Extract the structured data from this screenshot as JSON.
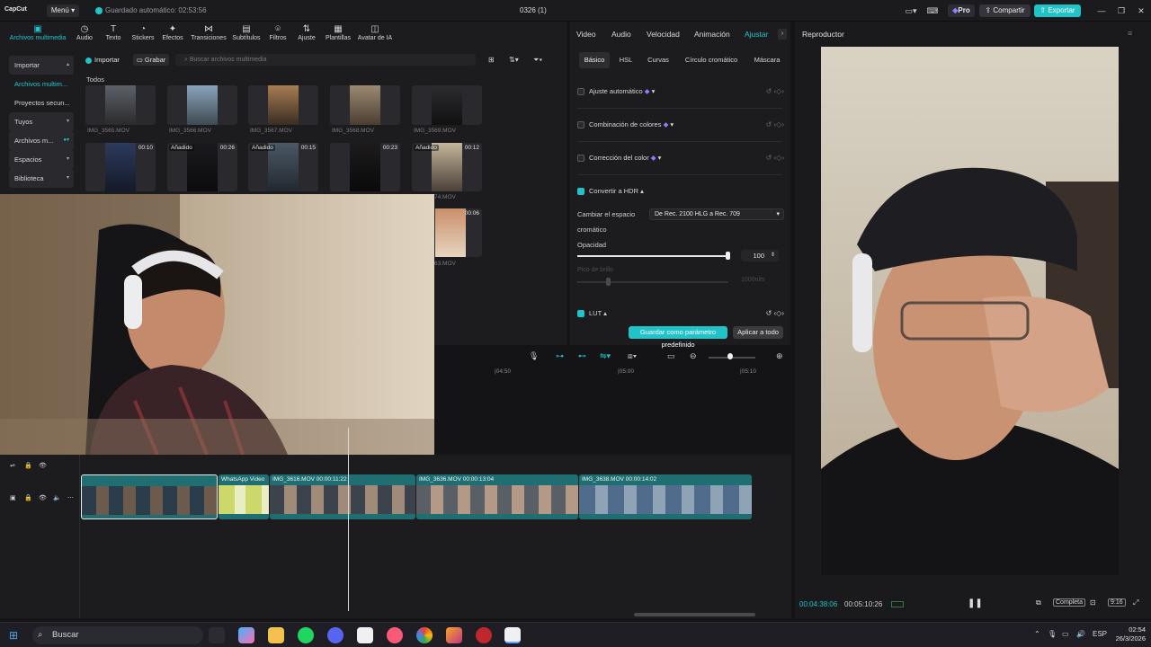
{
  "titlebar": {
    "app": "CapCut",
    "menu": "Menú",
    "autosave": "Guardado automático: 02:53:56",
    "project": "0326 (1)",
    "pro": "Pro",
    "share": "Compartir",
    "export": "Exportar"
  },
  "media": {
    "tools": [
      "Archivos multimedia",
      "Audio",
      "Texto",
      "Stickers",
      "Efectos",
      "Transiciones",
      "Subtítulos",
      "Filtros",
      "Ajuste",
      "Plantillas",
      "Avatar de IA"
    ],
    "tool_icons": [
      "media-icon",
      "audio-icon",
      "text-icon",
      "stickers-icon",
      "effects-icon",
      "transitions-icon",
      "subtitles-icon",
      "filters-icon",
      "adjust-icon",
      "templates-icon",
      "ai-avatar-icon"
    ],
    "sidebar": [
      "Importar",
      "Archivos multim...",
      "Proyectos secun...",
      "Tuyos",
      "Archivos m...",
      "Espacios",
      "Biblioteca"
    ],
    "import": "Importar",
    "record": "Grabar",
    "search_placeholder": "Buscar archivos multimedia",
    "section": "Todos",
    "row1": [
      "IMG_3565.MOV",
      "IMG_3566.MOV",
      "IMG_3567.MOV",
      "IMG_3568.MOV",
      "IMG_3569.MOV"
    ],
    "row2": [
      {
        "dur": "00:10",
        "added": ""
      },
      {
        "dur": "00:26",
        "added": "Añadido"
      },
      {
        "dur": "00:15",
        "added": "Añadido"
      },
      {
        "dur": "00:23",
        "added": ""
      },
      {
        "dur": "00:12",
        "added": "Añadido"
      }
    ],
    "row2_caps": [
      "",
      "",
      "",
      "",
      "74.MOV"
    ],
    "row3": {
      "dur": "00:06",
      "cap": "63.MOV"
    }
  },
  "adjust": {
    "tabs": [
      "Video",
      "Audio",
      "Velocidad",
      "Animación",
      "Ajustar"
    ],
    "subtabs": [
      "Básico",
      "HSL",
      "Curvas",
      "Círculo cromático",
      "Máscara"
    ],
    "auto": "Ajuste automático",
    "combine": "Combinación de colores",
    "correction": "Corrección del color",
    "hdr": "Convertir a HDR",
    "color_space_1": "Cambiar el espacio",
    "color_space_2": "cromático",
    "color_space_value": "De Rec. 2100 HLG a Rec. 709",
    "opacity": "Opacidad",
    "opacity_value": "100",
    "opacity_level": 1.0,
    "brightness_peak": "Pico de brillo",
    "brightness_value": "1000nits",
    "lut": "LUT",
    "save_preset": "Guardar como parámetro predefinido",
    "apply_all": "Aplicar a todo"
  },
  "player": {
    "title": "Reproductor",
    "current": "00:04:38:06",
    "total": "00:05:10:26",
    "full": "Completa",
    "ratio": "9:16"
  },
  "timeline": {
    "ticks": [
      "04:50",
      "05:00",
      "05:10"
    ],
    "clips": [
      {
        "label": ""
      },
      {
        "label": "WhatsApp Video"
      },
      {
        "label": "IMG_3616.MOV   00:00:11:22"
      },
      {
        "label": "IMG_3636.MOV   00:00:13:04"
      },
      {
        "label": "IMG_3638.MOV   00:00:14:02"
      }
    ]
  },
  "taskbar": {
    "search": "Buscar",
    "lang": "ESP",
    "time": "02:54",
    "date": "26/3/2026"
  },
  "colors": {
    "accent": "#21c3c9",
    "bg": "#141416",
    "panel": "#1c1c1f"
  }
}
